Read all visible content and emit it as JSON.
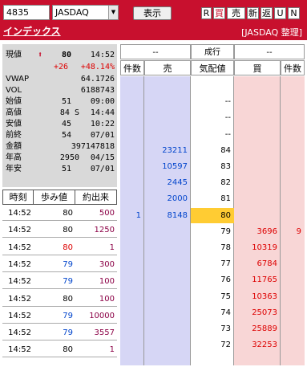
{
  "toolbar": {
    "code_value": "4835",
    "market_value": "JASDAQ",
    "show_label": "表示",
    "buttons": [
      "R",
      "買",
      "売",
      "新",
      "返",
      "U",
      "N"
    ]
  },
  "subheader": {
    "title": "インデックス",
    "market_label": "[JASDAQ 整理]"
  },
  "quote": {
    "current_label": "現値",
    "current_price": "80",
    "current_time": "14:52",
    "change": "+26",
    "change_pct": "+48.14%",
    "vwap_label": "VWAP",
    "vwap": "64.1726",
    "vol_label": "VOL",
    "vol": "6188743",
    "open_label": "始値",
    "open": "51",
    "open_time": "09:00",
    "high_label": "高値",
    "high": "84 S",
    "high_time": "14:44",
    "low_label": "安値",
    "low": "45",
    "low_time": "10:22",
    "prev_label": "前終",
    "prev": "54",
    "prev_date": "07/01",
    "amount_label": "金額",
    "amount": "397147818",
    "yhigh_label": "年高",
    "yhigh": "2950",
    "yhigh_date": "04/15",
    "ylow_label": "年安",
    "ylow": "51",
    "ylow_date": "07/01"
  },
  "trades": {
    "headers": [
      "時刻",
      "歩み値",
      "約出来"
    ],
    "rows": [
      {
        "time": "14:52",
        "price": "80",
        "qty": "500"
      },
      {
        "time": "14:52",
        "price": "80",
        "qty": "1250"
      },
      {
        "time": "14:52",
        "price": "80",
        "qty": "1"
      },
      {
        "time": "14:52",
        "price": "79",
        "qty": "300"
      },
      {
        "time": "14:52",
        "price": "79",
        "qty": "100"
      },
      {
        "time": "14:52",
        "price": "80",
        "qty": "100"
      },
      {
        "time": "14:52",
        "price": "79",
        "qty": "10000"
      },
      {
        "time": "14:52",
        "price": "79",
        "qty": "3557"
      },
      {
        "time": "14:52",
        "price": "80",
        "qty": "1"
      }
    ]
  },
  "book": {
    "top": [
      "--",
      "成行",
      "--"
    ],
    "headers": [
      "件数",
      "売",
      "気配値",
      "買",
      "件数"
    ],
    "rows": [
      {
        "sc": "",
        "sell": "",
        "price": "",
        "buy": "",
        "bc": ""
      },
      {
        "sc": "",
        "sell": "",
        "price": "--",
        "buy": "",
        "bc": ""
      },
      {
        "sc": "",
        "sell": "",
        "price": "--",
        "buy": "",
        "bc": ""
      },
      {
        "sc": "",
        "sell": "",
        "price": "--",
        "buy": "",
        "bc": ""
      },
      {
        "sc": "",
        "sell": "23211",
        "price": "84",
        "buy": "",
        "bc": ""
      },
      {
        "sc": "",
        "sell": "10597",
        "price": "83",
        "buy": "",
        "bc": ""
      },
      {
        "sc": "",
        "sell": "2445",
        "price": "82",
        "buy": "",
        "bc": ""
      },
      {
        "sc": "",
        "sell": "2000",
        "price": "81",
        "buy": "",
        "bc": ""
      },
      {
        "sc": "1",
        "sell": "8148",
        "price": "80",
        "buy": "",
        "bc": ""
      },
      {
        "sc": "",
        "sell": "",
        "price": "79",
        "buy": "3696",
        "bc": "9"
      },
      {
        "sc": "",
        "sell": "",
        "price": "78",
        "buy": "10319",
        "bc": ""
      },
      {
        "sc": "",
        "sell": "",
        "price": "77",
        "buy": "6784",
        "bc": ""
      },
      {
        "sc": "",
        "sell": "",
        "price": "76",
        "buy": "11765",
        "bc": ""
      },
      {
        "sc": "",
        "sell": "",
        "price": "75",
        "buy": "10363",
        "bc": ""
      },
      {
        "sc": "",
        "sell": "",
        "price": "74",
        "buy": "25073",
        "bc": ""
      },
      {
        "sc": "",
        "sell": "",
        "price": "73",
        "buy": "25889",
        "bc": ""
      },
      {
        "sc": "",
        "sell": "",
        "price": "72",
        "buy": "32253",
        "bc": ""
      },
      {
        "sc": "",
        "sell": "",
        "price": "",
        "buy": "",
        "bc": ""
      }
    ]
  },
  "colors": {
    "brand_red": "#c8102e",
    "sell_bg": "#d6d6f5",
    "buy_bg": "#f8d6d6",
    "current_bg": "#ffcc33"
  }
}
